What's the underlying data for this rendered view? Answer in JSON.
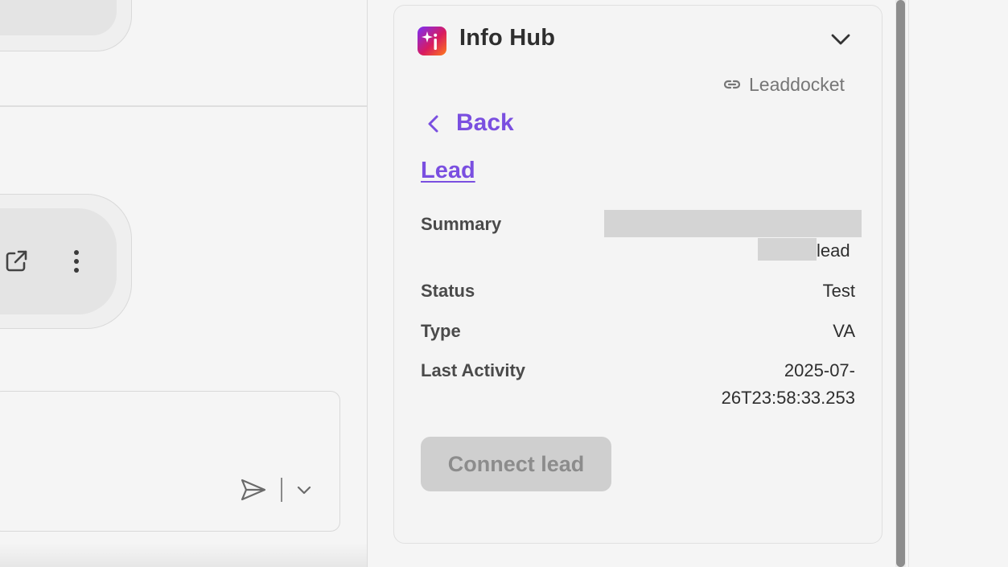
{
  "colors": {
    "accent": "#7a4fe0",
    "disabled_button_bg": "#cfcfcf",
    "disabled_button_text": "#8c8c8c"
  },
  "left_pane": {
    "icons": [
      "open-external-icon",
      "more-vertical-icon",
      "send-icon",
      "chevron-down-icon"
    ]
  },
  "info_hub": {
    "title": "Info Hub",
    "logo_icon": "sparkle-i-icon",
    "collapse_icon": "chevron-down-icon",
    "source_link": {
      "icon": "link-icon",
      "label": "Leaddocket"
    },
    "back_label": "Back",
    "section_title": "Lead",
    "fields": {
      "summary": {
        "label": "Summary",
        "value_suffix": "lead",
        "redacted": true
      },
      "status": {
        "label": "Status",
        "value": "Test"
      },
      "type": {
        "label": "Type",
        "value": "VA"
      },
      "last_activity": {
        "label": "Last Activity",
        "value_line1": "2025-07-",
        "value_line2": "26T23:58:33.253"
      }
    },
    "connect_button": {
      "label": "Connect lead",
      "disabled": true
    }
  }
}
